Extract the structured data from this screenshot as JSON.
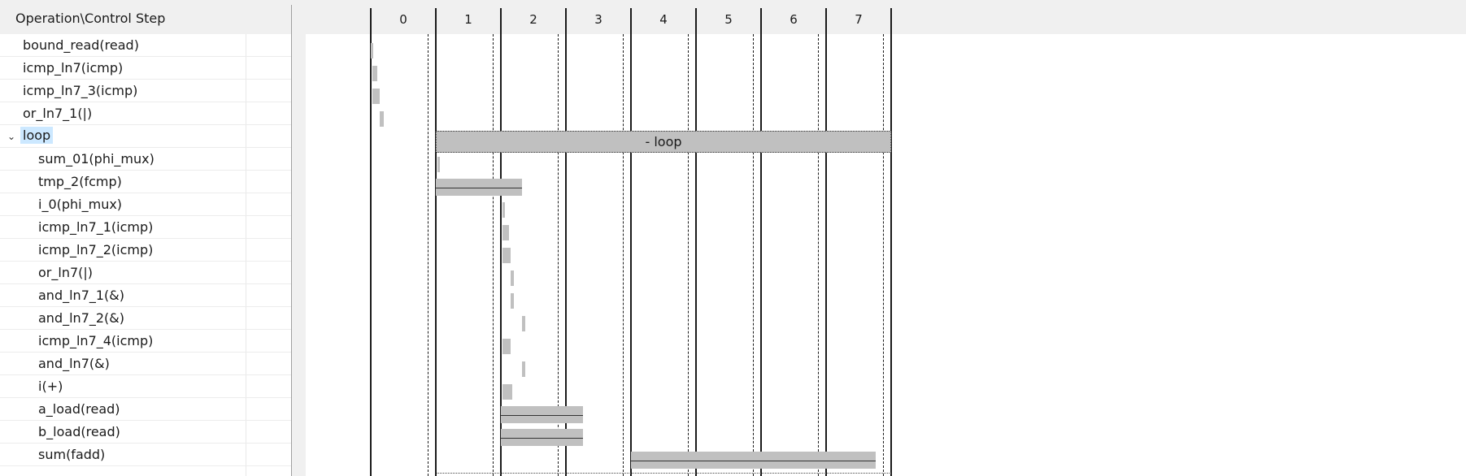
{
  "header": {
    "ops_column_title": "Operation\\Control Step"
  },
  "steps": [
    "0",
    "1",
    "2",
    "3",
    "4",
    "5",
    "6",
    "7"
  ],
  "operations": [
    {
      "label": "bound_read(read)",
      "level": 0,
      "start": 0,
      "end": 0.04
    },
    {
      "label": "icmp_ln7(icmp)",
      "level": 0,
      "start": 0.02,
      "end": 0.1
    },
    {
      "label": "icmp_ln7_3(icmp)",
      "level": 0,
      "start": 0.02,
      "end": 0.14
    },
    {
      "label": "or_ln7_1(|)",
      "level": 0,
      "start": 0.14,
      "end": 0.2
    },
    {
      "label": "loop",
      "level": 0,
      "group": true,
      "expanded": true,
      "bar_text": "- loop",
      "start": 1,
      "end": 8
    },
    {
      "label": "sum_01(phi_mux)",
      "level": 1,
      "start": 1.02,
      "end": 1.05
    },
    {
      "label": "tmp_2(fcmp)",
      "level": 1,
      "start": 1,
      "end": 2.33,
      "multi": true
    },
    {
      "label": "i_0(phi_mux)",
      "level": 1,
      "start": 2.02,
      "end": 2.05
    },
    {
      "label": "icmp_ln7_1(icmp)",
      "level": 1,
      "start": 2.02,
      "end": 2.12
    },
    {
      "label": "icmp_ln7_2(icmp)",
      "level": 1,
      "start": 2.02,
      "end": 2.15
    },
    {
      "label": "or_ln7(|)",
      "level": 1,
      "start": 2.15,
      "end": 2.2
    },
    {
      "label": "and_ln7_1(&)",
      "level": 1,
      "start": 2.15,
      "end": 2.2
    },
    {
      "label": "and_ln7_2(&)",
      "level": 1,
      "start": 2.33,
      "end": 2.38
    },
    {
      "label": "icmp_ln7_4(icmp)",
      "level": 1,
      "start": 2.02,
      "end": 2.15
    },
    {
      "label": "and_ln7(&)",
      "level": 1,
      "start": 2.33,
      "end": 2.38
    },
    {
      "label": "i(+)",
      "level": 1,
      "start": 2.02,
      "end": 2.17
    },
    {
      "label": "a_load(read)",
      "level": 1,
      "start": 2,
      "end": 3.26,
      "multi": true
    },
    {
      "label": "b_load(read)",
      "level": 1,
      "start": 2,
      "end": 3.26,
      "multi": true
    },
    {
      "label": "sum(fadd)",
      "level": 1,
      "start": 4,
      "end": 7.76,
      "multi": true
    }
  ],
  "colors": {
    "bar": "#c0c0c0",
    "selection": "#cce8ff",
    "panel_bg": "#f0f0f0"
  }
}
